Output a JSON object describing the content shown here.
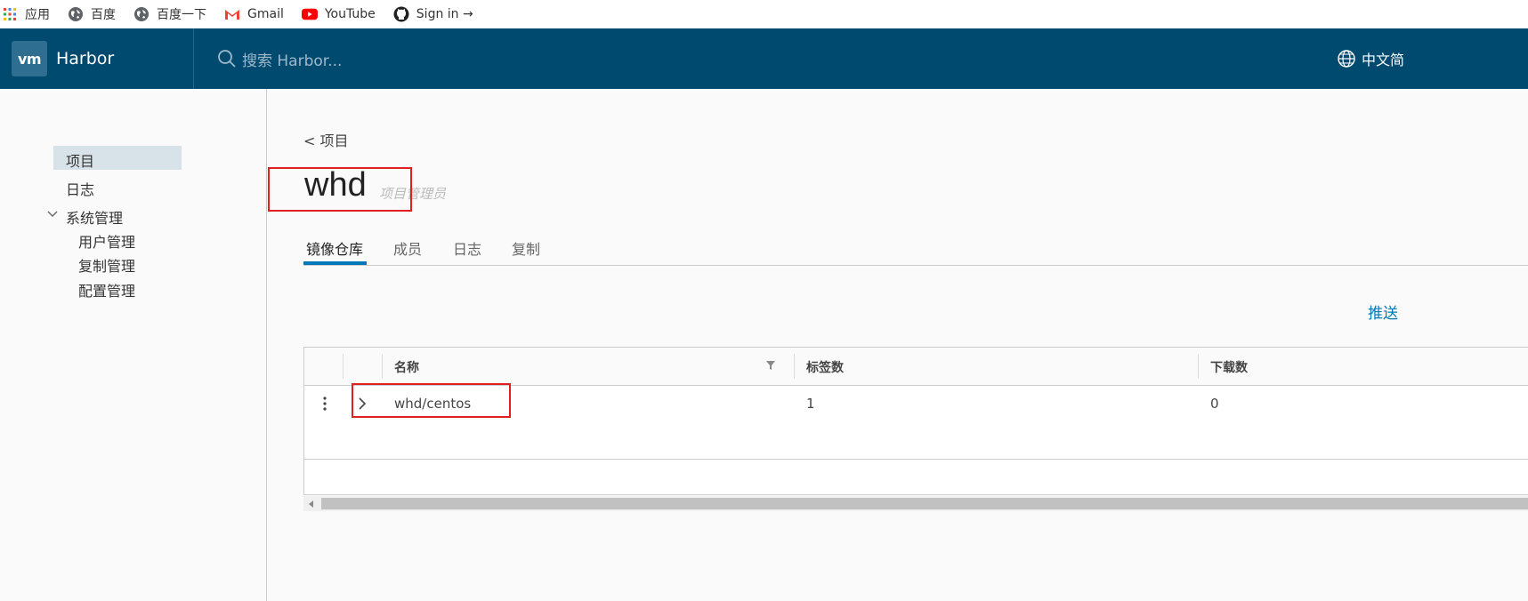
{
  "bookmarks": [
    {
      "label": "应用",
      "icon": "apps-grid-icon"
    },
    {
      "label": "百度",
      "icon": "globe-icon"
    },
    {
      "label": "百度一下",
      "icon": "globe-icon"
    },
    {
      "label": "Gmail",
      "icon": "gmail-icon"
    },
    {
      "label": "YouTube",
      "icon": "youtube-icon"
    },
    {
      "label": "Sign in →",
      "icon": "github-icon"
    }
  ],
  "header": {
    "logo_text": "vm",
    "app_name": "Harbor",
    "search_placeholder": "搜索 Harbor...",
    "language": "中文简"
  },
  "sidebar": {
    "items": [
      {
        "label": "项目"
      },
      {
        "label": "日志"
      },
      {
        "label": "系统管理"
      }
    ],
    "admin_items": [
      {
        "label": "用户管理"
      },
      {
        "label": "复制管理"
      },
      {
        "label": "配置管理"
      }
    ]
  },
  "main": {
    "breadcrumb": "< 项目",
    "project_name": "whd",
    "role": "项目管理员",
    "tabs": [
      {
        "label": "镜像仓库"
      },
      {
        "label": "成员"
      },
      {
        "label": "日志"
      },
      {
        "label": "复制"
      }
    ],
    "push_link": "推送",
    "table": {
      "columns": [
        "名称",
        "标签数",
        "下载数"
      ],
      "rows": [
        {
          "name": "whd/centos",
          "tags": "1",
          "pulls": "0"
        }
      ]
    }
  },
  "colors": {
    "header_bg": "#004a70",
    "accent": "#0079b8",
    "highlight_box": "#e02020"
  }
}
